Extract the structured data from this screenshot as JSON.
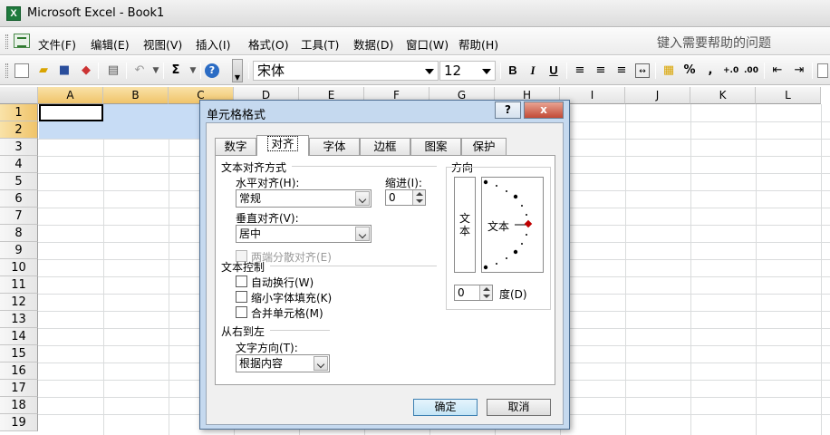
{
  "window": {
    "title": "Microsoft Excel - Book1",
    "app_icon": "X"
  },
  "menubar": {
    "items": [
      "文件(F)",
      "编辑(E)",
      "视图(V)",
      "插入(I)",
      "格式(O)",
      "工具(T)",
      "数据(D)",
      "窗口(W)",
      "帮助(H)"
    ],
    "help_search": "键入需要帮助的问题"
  },
  "toolbar": {
    "font_name": "宋体",
    "font_size": "12",
    "bold": "B",
    "italic": "I",
    "underline": "U",
    "autosum": "Σ",
    "percent": "%",
    "comma": ","
  },
  "grid": {
    "columns": [
      "A",
      "B",
      "C",
      "D",
      "E",
      "F",
      "G",
      "H",
      "I",
      "J",
      "K",
      "L"
    ],
    "rows": [
      "1",
      "2",
      "3",
      "4",
      "5",
      "6",
      "7",
      "8",
      "9",
      "10",
      "11",
      "12",
      "13",
      "14",
      "15",
      "16",
      "17",
      "18",
      "19"
    ]
  },
  "dialog": {
    "title": "单元格格式",
    "help": "?",
    "close": "x",
    "tabs": [
      "数字",
      "对齐",
      "字体",
      "边框",
      "图案",
      "保护"
    ],
    "active_tab": "对齐",
    "text_alignment_group": "文本对齐方式",
    "horizontal_label": "水平对齐(H):",
    "horizontal_value": "常规",
    "indent_label": "缩进(I):",
    "indent_value": "0",
    "vertical_label": "垂直对齐(V):",
    "vertical_value": "居中",
    "distributed_label": "两端分散对齐(E)",
    "text_control_group": "文本控制",
    "wrap_label": "自动换行(W)",
    "shrink_label": "缩小字体填充(K)",
    "merge_label": "合并单元格(M)",
    "rtl_group": "从右到左",
    "text_direction_label": "文字方向(T):",
    "text_direction_value": "根据内容",
    "orientation_group": "方向",
    "vertical_text": "文本",
    "orientation_text": "文本",
    "degree_value": "0",
    "degree_label": "度(D)",
    "ok": "确定",
    "cancel": "取消"
  }
}
